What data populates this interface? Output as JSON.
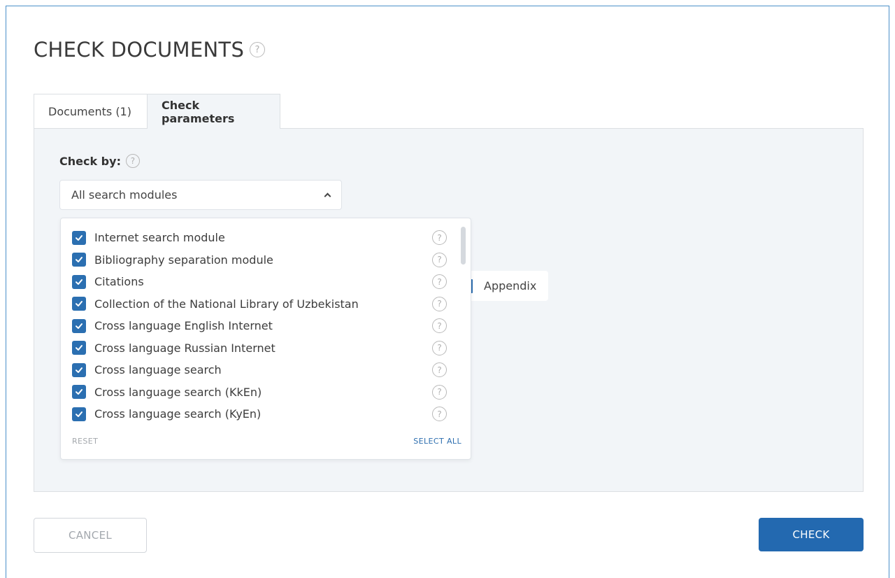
{
  "page": {
    "title": "CHECK DOCUMENTS",
    "help_glyph": "?"
  },
  "tabs": [
    {
      "label": "Documents (1)",
      "active": false
    },
    {
      "label": "Check parameters",
      "active": true
    }
  ],
  "check_by": {
    "label": "Check by:",
    "selected": "All search modules",
    "options": [
      {
        "label": "Internet search module",
        "checked": true
      },
      {
        "label": "Bibliography separation module",
        "checked": true
      },
      {
        "label": "Citations",
        "checked": true
      },
      {
        "label": "Collection of the National Library of Uzbekistan",
        "checked": true
      },
      {
        "label": "Cross language English Internet",
        "checked": true
      },
      {
        "label": "Cross language Russian Internet",
        "checked": true
      },
      {
        "label": "Cross language search",
        "checked": true
      },
      {
        "label": "Cross language search (KkEn)",
        "checked": true
      },
      {
        "label": "Cross language search (KyEn)",
        "checked": true
      }
    ],
    "reset_label": "RESET",
    "select_all_label": "SELECT ALL"
  },
  "appendix": {
    "label": "Appendix"
  },
  "actions": {
    "cancel_label": "CANCEL",
    "check_label": "CHECK"
  },
  "colors": {
    "accent": "#2369b0",
    "checkbox": "#2b6fb1",
    "panel_bg": "#f2f5f8",
    "frame_border": "#4a90c9"
  },
  "icons": {
    "help": "help-circle-icon",
    "checkbox_check": "check-icon",
    "dropdown_toggle": "chevron-up-icon"
  }
}
